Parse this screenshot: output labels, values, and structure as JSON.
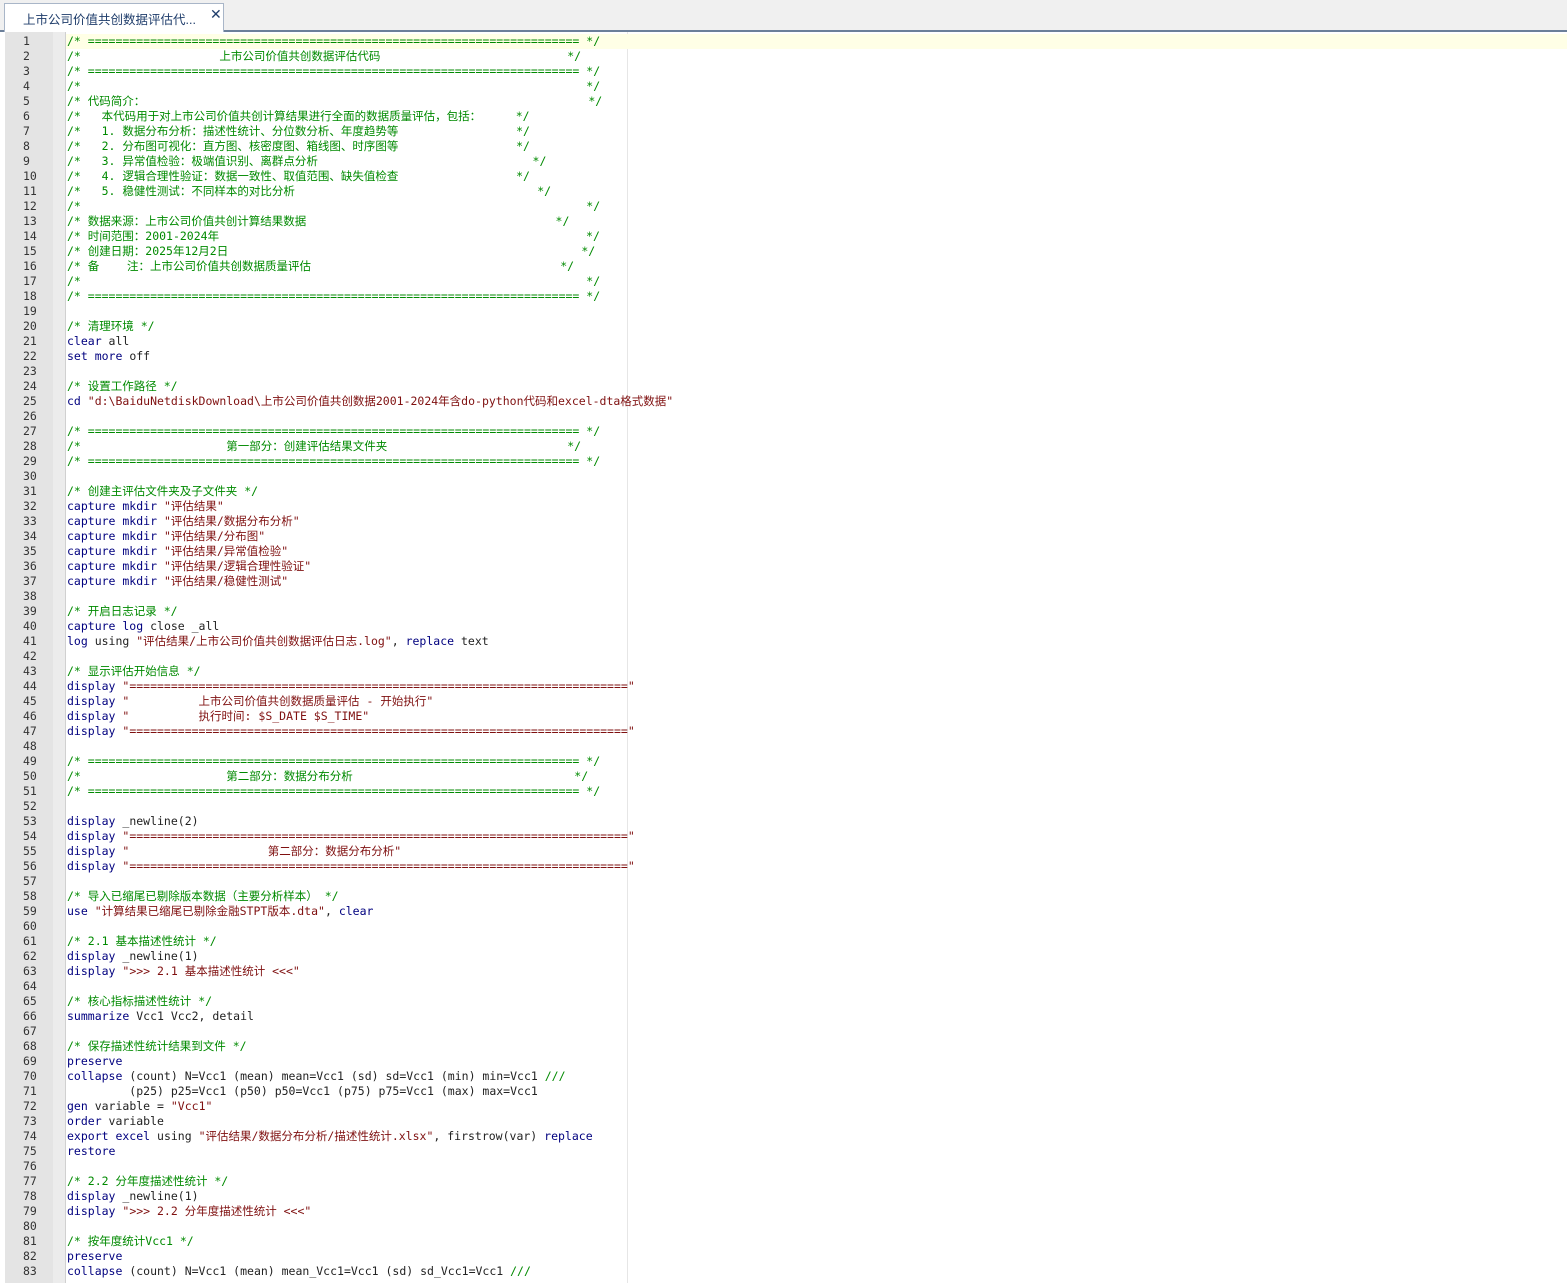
{
  "tab": {
    "title": "上市公司价值共创数据评估代...",
    "close_icon": "close-icon"
  },
  "lines": [
    {
      "n": "1",
      "parts": [
        {
          "t": "/* ======================================================================= */",
          "c": "cm"
        }
      ]
    },
    {
      "n": "2",
      "parts": [
        {
          "t": "/*                    上市公司价值共创数据评估代码                           */",
          "c": "cm"
        }
      ]
    },
    {
      "n": "3",
      "parts": [
        {
          "t": "/* ======================================================================= */",
          "c": "cm"
        }
      ]
    },
    {
      "n": "4",
      "parts": [
        {
          "t": "/*                                                                         */",
          "c": "cm"
        }
      ]
    },
    {
      "n": "5",
      "parts": [
        {
          "t": "/* 代码简介：                                                                */",
          "c": "cm"
        }
      ]
    },
    {
      "n": "6",
      "parts": [
        {
          "t": "/*   本代码用于对上市公司价值共创计算结果进行全面的数据质量评估，包括：     */",
          "c": "cm"
        }
      ]
    },
    {
      "n": "7",
      "parts": [
        {
          "t": "/*   1. 数据分布分析：描述性统计、分位数分析、年度趋势等                 */",
          "c": "cm"
        }
      ]
    },
    {
      "n": "8",
      "parts": [
        {
          "t": "/*   2. 分布图可视化：直方图、核密度图、箱线图、时序图等                 */",
          "c": "cm"
        }
      ]
    },
    {
      "n": "9",
      "parts": [
        {
          "t": "/*   3. 异常值检验：极端值识别、离群点分析                               */",
          "c": "cm"
        }
      ]
    },
    {
      "n": "10",
      "parts": [
        {
          "t": "/*   4. 逻辑合理性验证：数据一致性、取值范围、缺失值检查                 */",
          "c": "cm"
        }
      ]
    },
    {
      "n": "11",
      "parts": [
        {
          "t": "/*   5. 稳健性测试：不同样本的对比分析                                   */",
          "c": "cm"
        }
      ]
    },
    {
      "n": "12",
      "parts": [
        {
          "t": "/*                                                                         */",
          "c": "cm"
        }
      ]
    },
    {
      "n": "13",
      "parts": [
        {
          "t": "/* 数据来源：上市公司价值共创计算结果数据                                    */",
          "c": "cm"
        }
      ]
    },
    {
      "n": "14",
      "parts": [
        {
          "t": "/* 时间范围：2001-2024年                                                     */",
          "c": "cm"
        }
      ]
    },
    {
      "n": "15",
      "parts": [
        {
          "t": "/* 创建日期：2025年12月2日                                                   */",
          "c": "cm"
        }
      ]
    },
    {
      "n": "16",
      "parts": [
        {
          "t": "/* 备    注：上市公司价值共创数据质量评估                                    */",
          "c": "cm"
        }
      ]
    },
    {
      "n": "17",
      "parts": [
        {
          "t": "/*                                                                         */",
          "c": "cm"
        }
      ]
    },
    {
      "n": "18",
      "parts": [
        {
          "t": "/* ======================================================================= */",
          "c": "cm"
        }
      ]
    },
    {
      "n": "19",
      "parts": []
    },
    {
      "n": "20",
      "parts": [
        {
          "t": "/* 清理环境 */",
          "c": "cm"
        }
      ]
    },
    {
      "n": "21",
      "parts": [
        {
          "t": "clear",
          "c": "cmd"
        },
        {
          "t": " all",
          "c": ""
        }
      ]
    },
    {
      "n": "22",
      "parts": [
        {
          "t": "set more",
          "c": "cmd"
        },
        {
          "t": " off",
          "c": ""
        }
      ]
    },
    {
      "n": "23",
      "parts": []
    },
    {
      "n": "24",
      "parts": [
        {
          "t": "/* 设置工作路径 */",
          "c": "cm"
        }
      ]
    },
    {
      "n": "25",
      "parts": [
        {
          "t": "cd",
          "c": "cmd"
        },
        {
          "t": " \"d:\\BaiduNetdiskDownload\\上市公司价值共创数据2001-2024年含do-python代码和excel-dta格式数据\"",
          "c": "str"
        }
      ]
    },
    {
      "n": "26",
      "parts": []
    },
    {
      "n": "27",
      "parts": [
        {
          "t": "/* ======================================================================= */",
          "c": "cm"
        }
      ]
    },
    {
      "n": "28",
      "parts": [
        {
          "t": "/*                     第一部分：创建评估结果文件夹                          */",
          "c": "cm"
        }
      ]
    },
    {
      "n": "29",
      "parts": [
        {
          "t": "/* ======================================================================= */",
          "c": "cm"
        }
      ]
    },
    {
      "n": "30",
      "parts": []
    },
    {
      "n": "31",
      "parts": [
        {
          "t": "/* 创建主评估文件夹及子文件夹 */",
          "c": "cm"
        }
      ]
    },
    {
      "n": "32",
      "parts": [
        {
          "t": "capture mkdir",
          "c": "cmd"
        },
        {
          "t": " \"评估结果\"",
          "c": "str"
        }
      ]
    },
    {
      "n": "33",
      "parts": [
        {
          "t": "capture mkdir",
          "c": "cmd"
        },
        {
          "t": " \"评估结果/数据分布分析\"",
          "c": "str"
        }
      ]
    },
    {
      "n": "34",
      "parts": [
        {
          "t": "capture mkdir",
          "c": "cmd"
        },
        {
          "t": " \"评估结果/分布图\"",
          "c": "str"
        }
      ]
    },
    {
      "n": "35",
      "parts": [
        {
          "t": "capture mkdir",
          "c": "cmd"
        },
        {
          "t": " \"评估结果/异常值检验\"",
          "c": "str"
        }
      ]
    },
    {
      "n": "36",
      "parts": [
        {
          "t": "capture mkdir",
          "c": "cmd"
        },
        {
          "t": " \"评估结果/逻辑合理性验证\"",
          "c": "str"
        }
      ]
    },
    {
      "n": "37",
      "parts": [
        {
          "t": "capture mkdir",
          "c": "cmd"
        },
        {
          "t": " \"评估结果/稳健性测试\"",
          "c": "str"
        }
      ]
    },
    {
      "n": "38",
      "parts": []
    },
    {
      "n": "39",
      "parts": [
        {
          "t": "/* 开启日志记录 */",
          "c": "cm"
        }
      ]
    },
    {
      "n": "40",
      "parts": [
        {
          "t": "capture log",
          "c": "cmd"
        },
        {
          "t": " close _all",
          "c": ""
        }
      ]
    },
    {
      "n": "41",
      "parts": [
        {
          "t": "log",
          "c": "cmd"
        },
        {
          "t": " using ",
          "c": ""
        },
        {
          "t": "\"评估结果/上市公司价值共创数据评估日志.log\"",
          "c": "str"
        },
        {
          "t": ", ",
          "c": ""
        },
        {
          "t": "replace",
          "c": "cmd"
        },
        {
          "t": " text",
          "c": ""
        }
      ]
    },
    {
      "n": "42",
      "parts": []
    },
    {
      "n": "43",
      "parts": [
        {
          "t": "/* 显示评估开始信息 */",
          "c": "cm"
        }
      ]
    },
    {
      "n": "44",
      "parts": [
        {
          "t": "display",
          "c": "cmd"
        },
        {
          "t": " \"========================================================================\"",
          "c": "str"
        }
      ]
    },
    {
      "n": "45",
      "parts": [
        {
          "t": "display",
          "c": "cmd"
        },
        {
          "t": " \"          上市公司价值共创数据质量评估 - 开始执行\"",
          "c": "str"
        }
      ]
    },
    {
      "n": "46",
      "parts": [
        {
          "t": "display",
          "c": "cmd"
        },
        {
          "t": " \"          执行时间: $S_DATE $S_TIME\"",
          "c": "str"
        }
      ]
    },
    {
      "n": "47",
      "parts": [
        {
          "t": "display",
          "c": "cmd"
        },
        {
          "t": " \"========================================================================\"",
          "c": "str"
        }
      ]
    },
    {
      "n": "48",
      "parts": []
    },
    {
      "n": "49",
      "parts": [
        {
          "t": "/* ======================================================================= */",
          "c": "cm"
        }
      ]
    },
    {
      "n": "50",
      "parts": [
        {
          "t": "/*                     第二部分：数据分布分析                                */",
          "c": "cm"
        }
      ]
    },
    {
      "n": "51",
      "parts": [
        {
          "t": "/* ======================================================================= */",
          "c": "cm"
        }
      ]
    },
    {
      "n": "52",
      "parts": []
    },
    {
      "n": "53",
      "parts": [
        {
          "t": "display",
          "c": "cmd"
        },
        {
          "t": " _newline(2)",
          "c": ""
        }
      ]
    },
    {
      "n": "54",
      "parts": [
        {
          "t": "display",
          "c": "cmd"
        },
        {
          "t": " \"========================================================================\"",
          "c": "str"
        }
      ]
    },
    {
      "n": "55",
      "parts": [
        {
          "t": "display",
          "c": "cmd"
        },
        {
          "t": " \"                    第二部分：数据分布分析\"",
          "c": "str"
        }
      ]
    },
    {
      "n": "56",
      "parts": [
        {
          "t": "display",
          "c": "cmd"
        },
        {
          "t": " \"========================================================================\"",
          "c": "str"
        }
      ]
    },
    {
      "n": "57",
      "parts": []
    },
    {
      "n": "58",
      "parts": [
        {
          "t": "/* 导入已缩尾已剔除版本数据（主要分析样本） */",
          "c": "cm"
        }
      ]
    },
    {
      "n": "59",
      "parts": [
        {
          "t": "use",
          "c": "cmd"
        },
        {
          "t": " \"计算结果已缩尾已剔除金融STPT版本.dta\"",
          "c": "str"
        },
        {
          "t": ", ",
          "c": ""
        },
        {
          "t": "clear",
          "c": "cmd"
        }
      ]
    },
    {
      "n": "60",
      "parts": []
    },
    {
      "n": "61",
      "parts": [
        {
          "t": "/* 2.1 基本描述性统计 */",
          "c": "cm"
        }
      ]
    },
    {
      "n": "62",
      "parts": [
        {
          "t": "display",
          "c": "cmd"
        },
        {
          "t": " _newline(1)",
          "c": ""
        }
      ]
    },
    {
      "n": "63",
      "parts": [
        {
          "t": "display",
          "c": "cmd"
        },
        {
          "t": " \">>> 2.1 基本描述性统计 <<<\"",
          "c": "str"
        }
      ]
    },
    {
      "n": "64",
      "parts": []
    },
    {
      "n": "65",
      "parts": [
        {
          "t": "/* 核心指标描述性统计 */",
          "c": "cm"
        }
      ]
    },
    {
      "n": "66",
      "parts": [
        {
          "t": "summarize",
          "c": "cmd"
        },
        {
          "t": " Vcc1 Vcc2, detail",
          "c": ""
        }
      ]
    },
    {
      "n": "67",
      "parts": []
    },
    {
      "n": "68",
      "parts": [
        {
          "t": "/* 保存描述性统计结果到文件 */",
          "c": "cm"
        }
      ]
    },
    {
      "n": "69",
      "parts": [
        {
          "t": "preserve",
          "c": "cmd"
        }
      ]
    },
    {
      "n": "70",
      "parts": [
        {
          "t": "collapse",
          "c": "cmd"
        },
        {
          "t": " (count) N=Vcc1 (mean) mean=Vcc1 (sd) sd=Vcc1 (min) min=Vcc1 ",
          "c": ""
        },
        {
          "t": "///",
          "c": "cm"
        }
      ]
    },
    {
      "n": "71",
      "parts": [
        {
          "t": "         (p25) p25=Vcc1 (p50) p50=Vcc1 (p75) p75=Vcc1 (max) max=Vcc1",
          "c": ""
        }
      ]
    },
    {
      "n": "72",
      "parts": [
        {
          "t": "gen",
          "c": "cmd"
        },
        {
          "t": " variable = ",
          "c": ""
        },
        {
          "t": "\"Vcc1\"",
          "c": "str"
        }
      ]
    },
    {
      "n": "73",
      "parts": [
        {
          "t": "order",
          "c": "cmd"
        },
        {
          "t": " variable",
          "c": ""
        }
      ]
    },
    {
      "n": "74",
      "parts": [
        {
          "t": "export excel",
          "c": "cmd"
        },
        {
          "t": " using ",
          "c": ""
        },
        {
          "t": "\"评估结果/数据分布分析/描述性统计.xlsx\"",
          "c": "str"
        },
        {
          "t": ", firstrow(var) ",
          "c": ""
        },
        {
          "t": "replace",
          "c": "cmd"
        }
      ]
    },
    {
      "n": "75",
      "parts": [
        {
          "t": "restore",
          "c": "cmd"
        }
      ]
    },
    {
      "n": "76",
      "parts": []
    },
    {
      "n": "77",
      "parts": [
        {
          "t": "/* 2.2 分年度描述性统计 */",
          "c": "cm"
        }
      ]
    },
    {
      "n": "78",
      "parts": [
        {
          "t": "display",
          "c": "cmd"
        },
        {
          "t": " _newline(1)",
          "c": ""
        }
      ]
    },
    {
      "n": "79",
      "parts": [
        {
          "t": "display",
          "c": "cmd"
        },
        {
          "t": " \">>> 2.2 分年度描述性统计 <<<\"",
          "c": "str"
        }
      ]
    },
    {
      "n": "80",
      "parts": []
    },
    {
      "n": "81",
      "parts": [
        {
          "t": "/* 按年度统计Vcc1 */",
          "c": "cm"
        }
      ]
    },
    {
      "n": "82",
      "parts": [
        {
          "t": "preserve",
          "c": "cmd"
        }
      ]
    },
    {
      "n": "83",
      "parts": [
        {
          "t": "collapse",
          "c": "cmd"
        },
        {
          "t": " (count) N=Vcc1 (mean) mean_Vcc1=Vcc1 (sd) sd_Vcc1=Vcc1 ",
          "c": ""
        },
        {
          "t": "///",
          "c": "cm"
        }
      ]
    }
  ]
}
